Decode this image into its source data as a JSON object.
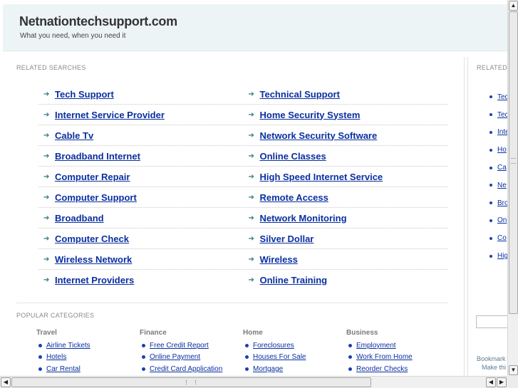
{
  "header": {
    "title": "Netnationtechsupport.com",
    "tagline": "What you need, when you need it"
  },
  "related_searches": {
    "label": "RELATED SEARCHES",
    "rows": [
      [
        "Tech Support",
        "Technical Support"
      ],
      [
        "Internet Service Provider",
        "Home Security System"
      ],
      [
        "Cable Tv",
        "Network Security Software"
      ],
      [
        "Broadband Internet",
        "Online Classes"
      ],
      [
        "Computer Repair",
        "High Speed Internet Service"
      ],
      [
        "Computer Support",
        "Remote Access"
      ],
      [
        "Broadband",
        "Network Monitoring"
      ],
      [
        "Computer Check",
        "Silver Dollar"
      ],
      [
        "Wireless Network",
        "Wireless"
      ],
      [
        "Internet Providers",
        "Online Training"
      ]
    ]
  },
  "popular_categories": {
    "label": "POPULAR CATEGORIES",
    "categories": [
      {
        "title": "Travel",
        "items": [
          "Airline Tickets",
          "Hotels",
          "Car Rental"
        ]
      },
      {
        "title": "Finance",
        "items": [
          "Free Credit Report",
          "Online Payment",
          "Credit Card Application"
        ]
      },
      {
        "title": "Home",
        "items": [
          "Foreclosures",
          "Houses For Sale",
          "Mortgage"
        ]
      },
      {
        "title": "Business",
        "items": [
          "Employment",
          "Work From Home",
          "Reorder Checks"
        ]
      }
    ]
  },
  "sidebar": {
    "label": "RELATED",
    "items": [
      "Tec",
      "Tec",
      "Inte",
      "Ho",
      "Ca",
      "Ne",
      "Bro",
      "On",
      "Co",
      "Hig"
    ],
    "bookmark_line1": "Bookmark",
    "bookmark_line2": "Make thi"
  },
  "icons": {
    "row_arrow": "arrow-right-icon",
    "scroll_up": "chevron-up-icon",
    "scroll_down": "chevron-down-icon",
    "scroll_left": "chevron-left-icon",
    "scroll_right": "chevron-right-icon"
  },
  "colors": {
    "link": "#0a2fa0",
    "arrow": "#2a7a7f",
    "header_bg": "#edf4f6"
  }
}
